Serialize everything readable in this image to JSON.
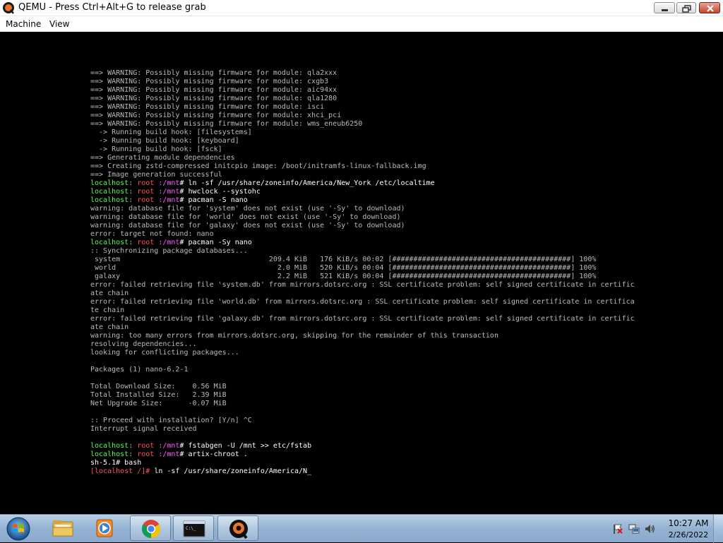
{
  "window": {
    "title": "QEMU - Press Ctrl+Alt+G to release grab"
  },
  "menu": {
    "items": [
      {
        "label": "Machine"
      },
      {
        "label": "View"
      }
    ]
  },
  "terminal": {
    "lines": [
      [
        {
          "t": "==> WARNING: Possibly missing firmware for module: qla2xxx",
          "c": ""
        }
      ],
      [
        {
          "t": "==> WARNING: Possibly missing firmware for module: cxgb3",
          "c": ""
        }
      ],
      [
        {
          "t": "==> WARNING: Possibly missing firmware for module: aic94xx",
          "c": ""
        }
      ],
      [
        {
          "t": "==> WARNING: Possibly missing firmware for module: qla1280",
          "c": ""
        }
      ],
      [
        {
          "t": "==> WARNING: Possibly missing firmware for module: isci",
          "c": ""
        }
      ],
      [
        {
          "t": "==> WARNING: Possibly missing firmware for module: xhci_pci",
          "c": ""
        }
      ],
      [
        {
          "t": "==> WARNING: Possibly missing firmware for module: wms_eneub6250",
          "c": ""
        }
      ],
      [
        {
          "t": "  -> Running build hook: [filesystems]",
          "c": ""
        }
      ],
      [
        {
          "t": "  -> Running build hook: [keyboard]",
          "c": ""
        }
      ],
      [
        {
          "t": "  -> Running build hook: [fsck]",
          "c": ""
        }
      ],
      [
        {
          "t": "==> Generating module dependencies",
          "c": ""
        }
      ],
      [
        {
          "t": "==> Creating zstd-compressed initcpio image: /boot/initramfs-linux-fallback.img",
          "c": ""
        }
      ],
      [
        {
          "t": "==> Image generation successful",
          "c": ""
        }
      ],
      [
        {
          "t": "localhost",
          "c": "grn"
        },
        {
          "t": ": ",
          "c": ""
        },
        {
          "t": "root",
          "c": "red"
        },
        {
          "t": " :/mnt",
          "c": "mag"
        },
        {
          "t": "# ln -sf /usr/share/zoneinfo/America/New_York /etc/localtime",
          "c": "wht"
        }
      ],
      [
        {
          "t": "localhost",
          "c": "grn"
        },
        {
          "t": ": ",
          "c": ""
        },
        {
          "t": "root",
          "c": "red"
        },
        {
          "t": " :/mnt",
          "c": "mag"
        },
        {
          "t": "# hwclock --systohc",
          "c": "wht"
        }
      ],
      [
        {
          "t": "localhost",
          "c": "grn"
        },
        {
          "t": ": ",
          "c": ""
        },
        {
          "t": "root",
          "c": "red"
        },
        {
          "t": " :/mnt",
          "c": "mag"
        },
        {
          "t": "# pacman -S nano",
          "c": "wht"
        }
      ],
      [
        {
          "t": "warning: database file for 'system' does not exist (use '-Sy' to download)",
          "c": ""
        }
      ],
      [
        {
          "t": "warning: database file for 'world' does not exist (use '-Sy' to download)",
          "c": ""
        }
      ],
      [
        {
          "t": "warning: database file for 'galaxy' does not exist (use '-Sy' to download)",
          "c": ""
        }
      ],
      [
        {
          "t": "error: target not found: nano",
          "c": ""
        }
      ],
      [
        {
          "t": "localhost",
          "c": "grn"
        },
        {
          "t": ": ",
          "c": ""
        },
        {
          "t": "root",
          "c": "red"
        },
        {
          "t": " :/mnt",
          "c": "mag"
        },
        {
          "t": "# pacman -Sy nano",
          "c": "wht"
        }
      ],
      [
        {
          "t": ":: Synchronizing package databases...",
          "c": ""
        }
      ],
      [
        {
          "t": " system                                   209.4 KiB   176 KiB/s 00:02 [##########################################] 100%",
          "c": ""
        }
      ],
      [
        {
          "t": " world                                      2.0 MiB   520 KiB/s 00:04 [##########################################] 100%",
          "c": ""
        }
      ],
      [
        {
          "t": " galaxy                                     2.2 MiB   521 KiB/s 00:04 [##########################################] 100%",
          "c": ""
        }
      ],
      [
        {
          "t": "error: failed retrieving file 'system.db' from mirrors.dotsrc.org : SSL certificate problem: self signed certificate in certific",
          "c": ""
        }
      ],
      [
        {
          "t": "ate chain",
          "c": ""
        }
      ],
      [
        {
          "t": "error: failed retrieving file 'world.db' from mirrors.dotsrc.org : SSL certificate problem: self signed certificate in certifica",
          "c": ""
        }
      ],
      [
        {
          "t": "te chain",
          "c": ""
        }
      ],
      [
        {
          "t": "error: failed retrieving file 'galaxy.db' from mirrors.dotsrc.org : SSL certificate problem: self signed certificate in certific",
          "c": ""
        }
      ],
      [
        {
          "t": "ate chain",
          "c": ""
        }
      ],
      [
        {
          "t": "warning: too many errors from mirrors.dotsrc.org, skipping for the remainder of this transaction",
          "c": ""
        }
      ],
      [
        {
          "t": "resolving dependencies...",
          "c": ""
        }
      ],
      [
        {
          "t": "looking for conflicting packages...",
          "c": ""
        }
      ],
      [
        {
          "t": "",
          "c": ""
        }
      ],
      [
        {
          "t": "Packages (1) nano-6.2-1",
          "c": ""
        }
      ],
      [
        {
          "t": "",
          "c": ""
        }
      ],
      [
        {
          "t": "Total Download Size:    0.56 MiB",
          "c": ""
        }
      ],
      [
        {
          "t": "Total Installed Size:   2.39 MiB",
          "c": ""
        }
      ],
      [
        {
          "t": "Net Upgrade Size:      -0.07 MiB",
          "c": ""
        }
      ],
      [
        {
          "t": "",
          "c": ""
        }
      ],
      [
        {
          "t": ":: Proceed with installation? [Y/n] ^C",
          "c": ""
        }
      ],
      [
        {
          "t": "Interrupt signal received",
          "c": ""
        }
      ],
      [
        {
          "t": "",
          "c": ""
        }
      ],
      [
        {
          "t": "localhost",
          "c": "grn"
        },
        {
          "t": ": ",
          "c": ""
        },
        {
          "t": "root",
          "c": "red"
        },
        {
          "t": " :/mnt",
          "c": "mag"
        },
        {
          "t": "# fstabgen -U /mnt >> etc/fstab",
          "c": "wht"
        }
      ],
      [
        {
          "t": "localhost",
          "c": "grn"
        },
        {
          "t": ": ",
          "c": ""
        },
        {
          "t": "root",
          "c": "red"
        },
        {
          "t": " :/mnt",
          "c": "mag"
        },
        {
          "t": "# artix-chroot .",
          "c": "wht"
        }
      ],
      [
        {
          "t": "sh-5.1# bash",
          "c": "wht"
        }
      ],
      [
        {
          "t": "[localhost /]# ",
          "c": "red"
        },
        {
          "t": "ln -sf /usr/share/zoneinfo/America/N_",
          "c": "wht"
        }
      ]
    ]
  },
  "taskbar": {
    "items": [
      {
        "name": "windows-explorer",
        "icon": "folder-icon"
      },
      {
        "name": "media-player",
        "icon": "media-player-icon"
      },
      {
        "name": "chrome",
        "icon": "chrome-icon"
      },
      {
        "name": "command-prompt",
        "icon": "cmd-icon"
      },
      {
        "name": "qemu",
        "icon": "qemu-icon"
      }
    ],
    "tray": {
      "time": "10:27 AM",
      "date": "2/26/2022"
    }
  },
  "colors": {
    "prompt_host": "#54ff54",
    "prompt_user": "#ff5454",
    "prompt_path": "#ff54ff",
    "terminal_text": "#bbbbbb",
    "terminal_bg": "#000000"
  }
}
